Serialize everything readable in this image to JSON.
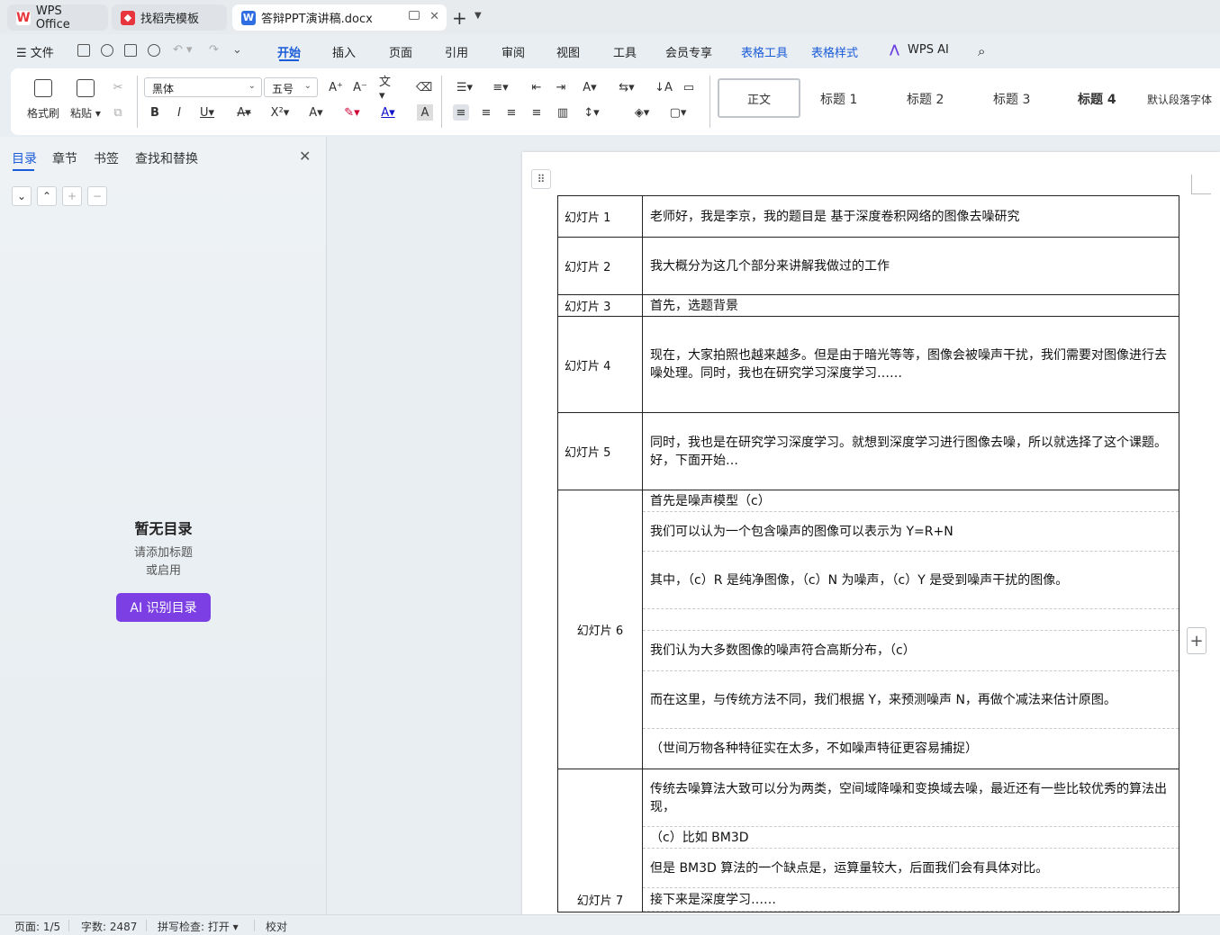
{
  "tabs": [
    {
      "label": "WPS Office",
      "icon": "wps-logo-icon"
    },
    {
      "label": "找稻壳模板",
      "icon": "docer-icon"
    },
    {
      "label": "答辩PPT演讲稿.docx",
      "icon": "word-doc-icon",
      "active": true
    }
  ],
  "menubar": {
    "file": "文件",
    "items": [
      "开始",
      "插入",
      "页面",
      "引用",
      "审阅",
      "视图",
      "工具",
      "会员专享"
    ],
    "active": "开始",
    "context_items": [
      "表格工具",
      "表格样式"
    ],
    "ai": "WPS AI"
  },
  "ribbon": {
    "format_painter": "格式刷",
    "paste": "粘贴",
    "font_name": "黑体",
    "font_size": "五号",
    "styles": [
      "正文",
      "标题 1",
      "标题 2",
      "标题 3",
      "标题 4",
      "默认段落字体"
    ]
  },
  "sidebar": {
    "tabs": [
      "目录",
      "章节",
      "书签",
      "查找和替换"
    ],
    "active": "目录",
    "empty_title": "暂无目录",
    "empty_line1": "请添加标题",
    "empty_line2": "或启用",
    "ai_button": "AI 识别目录"
  },
  "document": {
    "rows": [
      {
        "slide": "幻灯片 1",
        "text": "老师好，我是李京，我的题目是 基于深度卷积网络的图像去噪研究"
      },
      {
        "slide": "幻灯片 2",
        "text": "我大概分为这几个部分来讲解我做过的工作"
      },
      {
        "slide": "幻灯片 3",
        "text": "首先，选题背景"
      },
      {
        "slide": "幻灯片 4",
        "text": "现在，大家拍照也越来越多。但是由于暗光等等，图像会被噪声干扰，我们需要对图像进行去噪处理。同时，我也在研究学习深度学习……"
      },
      {
        "slide": "幻灯片 5",
        "text": "同时，我也是在研究学习深度学习。就想到深度学习进行图像去噪，所以就选择了这个课题。好，下面开始…"
      },
      {
        "slide": "幻灯片 6",
        "lines": [
          "首先是噪声模型（c）",
          "我们可以认为一个包含噪声的图像可以表示为 Y=R+N",
          "其中，（c）R 是纯净图像，（c）N 为噪声，（c）Y 是受到噪声干扰的图像。",
          "",
          "我们认为大多数图像的噪声符合高斯分布，（c）",
          "而在这里，与传统方法不同，我们根据 Y，来预测噪声 N，再做个减法来估计原图。",
          "（世间万物各种特征实在太多，不如噪声特征更容易捕捉）"
        ]
      },
      {
        "slide": "幻灯片 7",
        "lines": [
          "传统去噪算法大致可以分为两类，空间域降噪和变换域去噪，最近还有一些比较优秀的算法出现，",
          "（c）比如 BM3D",
          "但是 BM3D 算法的一个缺点是，运算量较大，后面我们会有具体对比。",
          "接下来是深度学习……"
        ]
      }
    ]
  },
  "statusbar": {
    "page": "页面: 1/5",
    "words": "字数: 2487",
    "spell": "拼写检查: 打开",
    "proof": "校对"
  }
}
